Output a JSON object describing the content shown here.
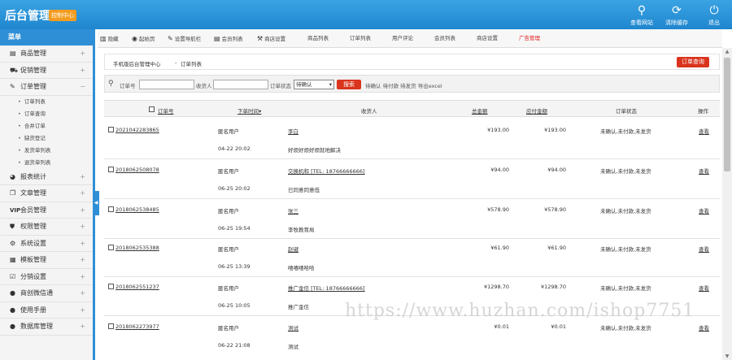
{
  "brand": {
    "title": "后台管理",
    "badge": "控制中心"
  },
  "toolbar": {
    "view_site": "查看网站",
    "clear_cache": "清除缓存",
    "exit": "退出"
  },
  "sidebar": {
    "header": "菜单",
    "items": [
      {
        "label": "商品管理",
        "pm": "+"
      },
      {
        "label": "促销管理",
        "pm": "+"
      },
      {
        "label": "订单管理",
        "pm": "−"
      }
    ],
    "subitems": [
      "订单列表",
      "订单查询",
      "合并订单",
      "缺货登记",
      "发货单列表",
      "退货单列表"
    ],
    "items2": [
      {
        "label": "报表统计",
        "pm": "+"
      },
      {
        "label": "文章管理",
        "pm": "+"
      },
      {
        "label": "会员管理",
        "pm": "+"
      },
      {
        "label": "权限管理",
        "pm": "+"
      },
      {
        "label": "系统设置",
        "pm": "+"
      },
      {
        "label": "模板管理",
        "pm": "+"
      },
      {
        "label": "分销设置",
        "pm": "+"
      },
      {
        "label": "商创微信通",
        "pm": "+"
      },
      {
        "label": "使用手册",
        "pm": "+"
      },
      {
        "label": "数据库管理",
        "pm": "+"
      }
    ]
  },
  "nav": {
    "items": [
      "隐藏",
      "起始页",
      "设置导航栏",
      "会员列表",
      "商店设置",
      "商品列表",
      "订单列表",
      "用户评论",
      "会员列表",
      "商店设置"
    ],
    "ad": "广告管理"
  },
  "breadcrumb": {
    "home": "手机版后台管理中心",
    "sep": "-",
    "page": "订单列表",
    "query_btn": "订单查询"
  },
  "search": {
    "order_no": "订单号",
    "consignee": "收货人",
    "status": "订单状态",
    "status_value": "待确认",
    "search_btn": "搜索",
    "links": "待确认 待付款 待发货 导出excel"
  },
  "table": {
    "headers": {
      "order_no": "订单号",
      "time": "下单时间",
      "consignee": "收货人",
      "total": "总金额",
      "payable": "应付金额",
      "status": "订单状态",
      "op": "操作"
    },
    "rows": [
      {
        "no": "2021042283865",
        "user": "匿名用户",
        "time": "04-22 20:02",
        "name": "李白",
        "addr": "好烦好烦好烦就地解决",
        "total": "¥193.00",
        "pay": "¥193.00",
        "status": "未确认,未付款,未发货",
        "op": "查看"
      },
      {
        "no": "2018062508078",
        "user": "匿名用户",
        "time": "06-25 20:02",
        "name": "交换机和 [TEL: 18766666666]",
        "addr": "已同意同意低",
        "total": "¥94.00",
        "pay": "¥94.00",
        "status": "未确认,未付款,未发货",
        "op": "查看"
      },
      {
        "no": "2018062538485",
        "user": "匿名用户",
        "time": "06-25 19:54",
        "name": "张三",
        "addr": "李牧教育局",
        "total": "¥578.90",
        "pay": "¥578.90",
        "status": "未确认,未付款,未发货",
        "op": "查看"
      },
      {
        "no": "2018062535388",
        "user": "匿名用户",
        "time": "06-25 13:39",
        "name": "赵键",
        "addr": "嘻嘻嘻哈哈",
        "total": "¥61.90",
        "pay": "¥61.90",
        "status": "未确认,未付款,未发货",
        "op": "查看"
      },
      {
        "no": "2018062551237",
        "user": "匿名用户",
        "time": "06-25 10:05",
        "name": "推广金信 [TEL: 18766666666]",
        "addr": "推广金信",
        "total": "¥1298.70",
        "pay": "¥1298.70",
        "status": "未确认,未付款,未发货",
        "op": "查看"
      },
      {
        "no": "2018062273977",
        "user": "匿名用户",
        "time": "06-22 21:08",
        "name": "测试",
        "addr": "测试",
        "total": "¥0.01",
        "pay": "¥0.01",
        "status": "未确认,未付款,未发货",
        "op": "查看"
      }
    ]
  },
  "watermark": "https://www.huzhan.com/ishop7751"
}
